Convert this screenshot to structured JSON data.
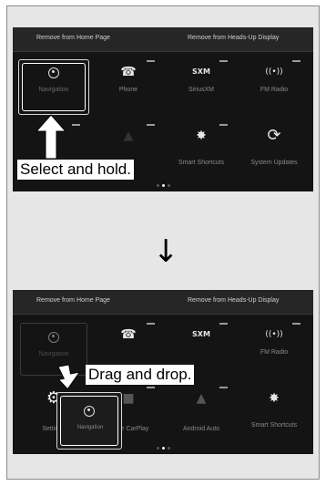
{
  "top_screen": {
    "header_left": "Remove from Home Page",
    "header_right": "Remove from Heads-Up Display",
    "tiles": [
      {
        "label": "Navigation",
        "icon": "navigation-icon"
      },
      {
        "label": "Phone",
        "icon": "phone-icon",
        "glyph": "☎"
      },
      {
        "label": "SiriusXM",
        "icon": "siriusxm-icon",
        "glyph": "SXM"
      },
      {
        "label": "FM Radio",
        "icon": "fm-radio-icon",
        "glyph": "((•))"
      },
      {
        "label": "",
        "icon": "blank-tile"
      },
      {
        "label": "",
        "icon": "android-auto-icon",
        "glyph": "▲"
      },
      {
        "label": "Smart Shortcuts",
        "icon": "smart-shortcuts-icon",
        "glyph": "✸"
      },
      {
        "label": "System Updates",
        "icon": "system-updates-icon",
        "glyph": "⟳"
      }
    ],
    "callout": "Select and hold."
  },
  "transition_arrow": "↓",
  "bottom_screen": {
    "header_left": "Remove from Home Page",
    "header_right": "Remove from Heads-Up Display",
    "tiles": [
      {
        "label": "Navigation",
        "icon": "navigation-icon"
      },
      {
        "label": "Phone",
        "icon": "phone-icon",
        "glyph": "☎"
      },
      {
        "label": "SiriusXM",
        "icon": "siriusxm-icon",
        "glyph": "SXM"
      },
      {
        "label": "FM Radio",
        "icon": "fm-radio-icon",
        "glyph": "((•))"
      },
      {
        "label": "Settings",
        "icon": "settings-icon",
        "glyph": "⚙"
      },
      {
        "label": "Apple CarPlay",
        "icon": "apple-carplay-icon",
        "glyph": "■"
      },
      {
        "label": "Android Auto",
        "icon": "android-auto-icon",
        "glyph": "▲"
      },
      {
        "label": "Smart Shortcuts",
        "icon": "smart-shortcuts-icon",
        "glyph": "✸"
      }
    ],
    "dragged_tile_label": "Navigation",
    "callout": "Drag and drop."
  },
  "colors": {
    "screen_bg": "#141414",
    "panel_bg": "#e6e6e6",
    "highlight": "#ffffff"
  }
}
